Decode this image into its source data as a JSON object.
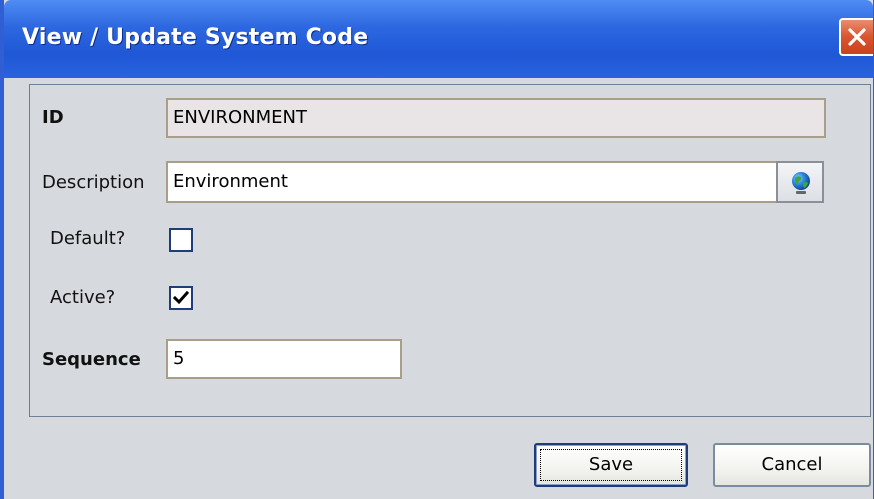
{
  "window": {
    "title": "View / Update System Code"
  },
  "form": {
    "id_label": "ID",
    "id_value": "ENVIRONMENT",
    "description_label": "Description",
    "description_value": "Environment",
    "default_label": "Default?",
    "default_checked": false,
    "active_label": "Active?",
    "active_checked": true,
    "sequence_label": "Sequence",
    "sequence_value": "5"
  },
  "icons": {
    "close": "close-icon",
    "globe": "globe-icon",
    "check": "checkmark-icon"
  },
  "buttons": {
    "save_label": "Save",
    "cancel_label": "Cancel"
  },
  "colors": {
    "titlebar": "#2d67e0",
    "close_button": "#d9542f",
    "dialog_background": "#d6d9dd"
  }
}
